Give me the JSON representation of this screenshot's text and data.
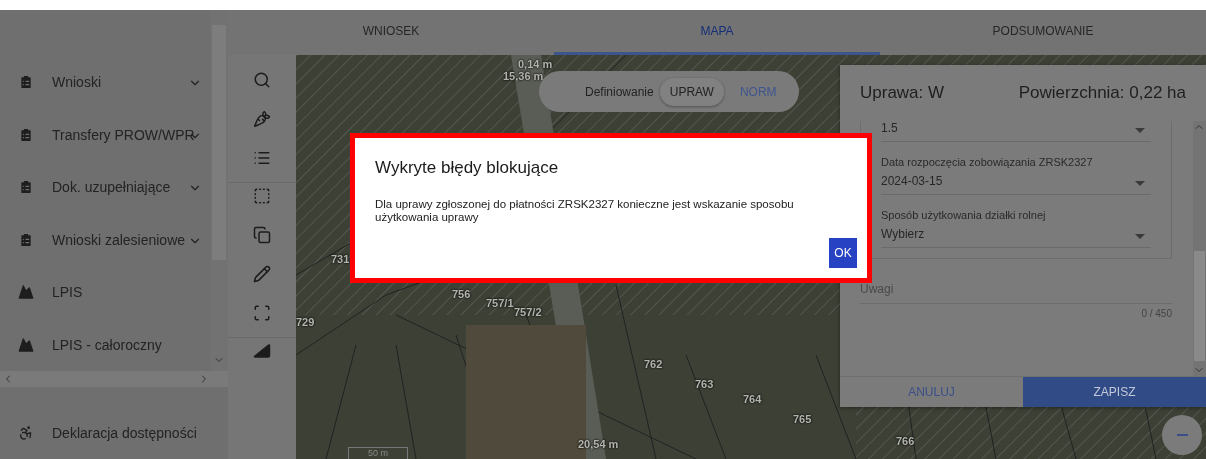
{
  "tabs": [
    {
      "label": "WNIOSEK",
      "selected": false
    },
    {
      "label": "MAPA",
      "selected": true
    },
    {
      "label": "PODSUMOWANIE",
      "selected": false
    }
  ],
  "sidebar": {
    "items": [
      {
        "label": "Wnioski",
        "kind": "document",
        "expandable": true
      },
      {
        "label": "Transfery PROW/WPR",
        "kind": "document",
        "expandable": true
      },
      {
        "label": "Dok. uzupełniające",
        "kind": "document",
        "expandable": true
      },
      {
        "label": "Wnioski zalesieniowe",
        "kind": "document",
        "expandable": true
      },
      {
        "label": "LPIS",
        "kind": "map",
        "expandable": false
      },
      {
        "label": "LPIS - całoroczny",
        "kind": "map",
        "expandable": false
      }
    ],
    "footer_item": {
      "label": "Deklaracja dostępności"
    }
  },
  "map": {
    "mode_switch": {
      "label": "Definiowanie",
      "options": [
        {
          "label": "UPRAW",
          "selected": true
        },
        {
          "label": "NORM",
          "selected": false
        }
      ]
    },
    "labels": [
      "0,14 m",
      "15,36 m",
      "731",
      "756",
      "757/1",
      "757/2",
      "729",
      "762",
      "763",
      "764",
      "765",
      "766",
      "20,54 m"
    ],
    "scale": "50 m"
  },
  "crop_panel": {
    "title": "Uprawa: W",
    "area": "Powierzchnia: 0,22 ha",
    "fields": [
      {
        "value": "1.5"
      },
      {
        "label": "Data rozpoczęcia zobowiązania ZRSK2327",
        "value": "2024-03-15"
      },
      {
        "label": "Sposób użytkowania działki rolnej",
        "value": "Wybierz"
      }
    ],
    "notes": {
      "placeholder": "Uwagi",
      "counter": "0 / 450"
    },
    "buttons": [
      {
        "label": "ANULUJ",
        "primary": false
      },
      {
        "label": "ZAPISZ",
        "primary": true
      }
    ]
  },
  "dialog": {
    "title": "Wykryte błędy blokujące",
    "message": "Dla uprawy zgłoszonej do płatności ZRSK2327 konieczne jest wskazanie sposobu użytkowania uprawy",
    "button": "OK"
  }
}
